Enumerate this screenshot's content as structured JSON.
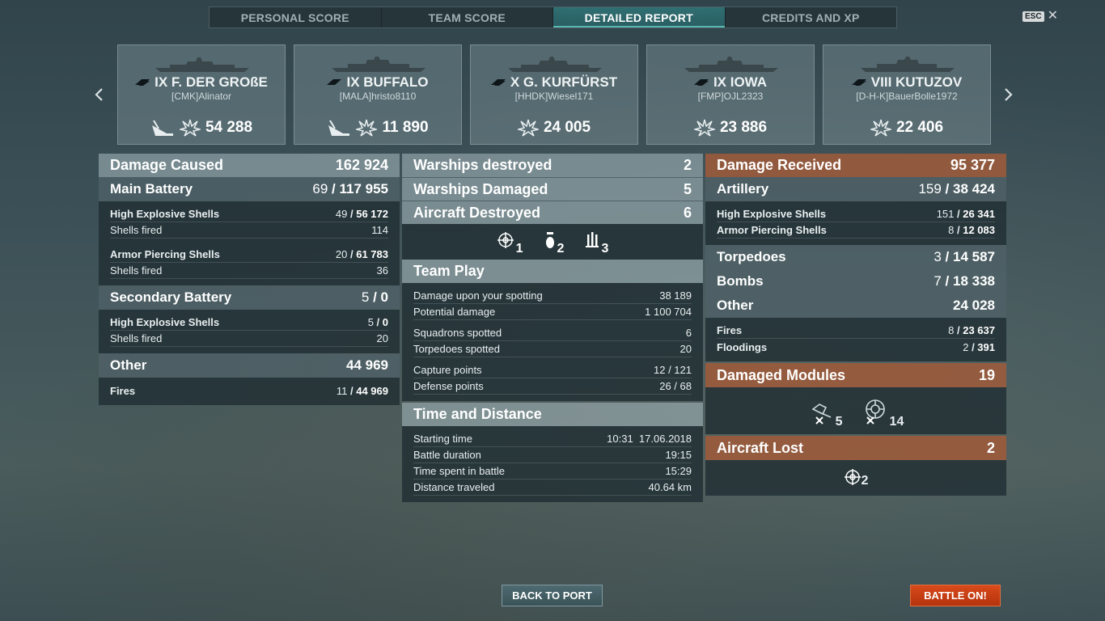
{
  "tabs": [
    {
      "label": "PERSONAL SCORE"
    },
    {
      "label": "TEAM SCORE"
    },
    {
      "label": "DETAILED REPORT"
    },
    {
      "label": "CREDITS AND XP"
    }
  ],
  "esc": {
    "key": "ESC",
    "close": "✕"
  },
  "ships": [
    {
      "name": "IX F. DER GROßE",
      "player": "[CMK]Alinator",
      "damage": "54 288",
      "sunk_icon": true
    },
    {
      "name": "IX BUFFALO",
      "player": "[MALA]hristo8110",
      "damage": "11 890",
      "sunk_icon": true
    },
    {
      "name": "X G. KURFÜRST",
      "player": "[HHDK]Wiesel171",
      "damage": "24 005",
      "sunk_icon": false
    },
    {
      "name": "IX IOWA",
      "player": "[FMP]OJL2323",
      "damage": "23 886",
      "sunk_icon": false
    },
    {
      "name": "VIII KUTUZOV",
      "player": "[D-H-K]BauerBolle1972",
      "damage": "22 406",
      "sunk_icon": false
    }
  ],
  "damage_caused": {
    "title": "Damage Caused",
    "total": "162 924",
    "main_battery": {
      "title": "Main Battery",
      "hits": "69",
      "dmg": "117 955"
    },
    "mb_rows": [
      {
        "label": "High Explosive Shells",
        "hits": "49",
        "dmg": "56 172",
        "bold": true
      },
      {
        "label": "Shells fired",
        "value": "114",
        "bold": false
      },
      {
        "label": "Armor Piercing Shells",
        "hits": "20",
        "dmg": "61 783",
        "bold": true
      },
      {
        "label": "Shells fired",
        "value": "36",
        "bold": false
      }
    ],
    "secondary": {
      "title": "Secondary Battery",
      "hits": "5",
      "dmg": "0"
    },
    "sec_rows": [
      {
        "label": "High Explosive Shells",
        "hits": "5",
        "dmg": "0"
      },
      {
        "label": "Shells fired",
        "value": "20"
      }
    ],
    "other": {
      "title": "Other",
      "total": "44 969"
    },
    "other_rows": [
      {
        "label": "Fires",
        "hits": "11",
        "dmg": "44 969"
      }
    ]
  },
  "middle": {
    "warships_destroyed": {
      "label": "Warships destroyed",
      "value": "2"
    },
    "warships_damaged": {
      "label": "Warships Damaged",
      "value": "5"
    },
    "aircraft_destroyed": {
      "label": "Aircraft Destroyed",
      "value": "6"
    },
    "aircraft_icons": [
      {
        "icon": "fighter-icon",
        "count": "1"
      },
      {
        "icon": "bomber-icon",
        "count": "2"
      },
      {
        "icon": "torpedo-bomber-icon",
        "count": "3"
      }
    ],
    "team_play": {
      "title": "Team Play"
    },
    "team_rows": [
      {
        "label": "Damage upon your spotting",
        "value": "38 189"
      },
      {
        "label": "Potential damage",
        "value": "1 100 704"
      },
      {
        "label": "Squadrons spotted",
        "value": "6"
      },
      {
        "label": "Torpedoes spotted",
        "value": "20"
      },
      {
        "label": "Capture points",
        "value": "12 / 121"
      },
      {
        "label": "Defense points",
        "value": "26 / 68"
      }
    ],
    "time_distance": {
      "title": "Time and Distance"
    },
    "time_rows": [
      {
        "label": "Starting time",
        "value": "10:31  17.06.2018"
      },
      {
        "label": "Battle duration",
        "value": "19:15"
      },
      {
        "label": "Time spent in battle",
        "value": "15:29"
      },
      {
        "label": "Distance traveled",
        "value": "40.64 km"
      }
    ]
  },
  "damage_received": {
    "title": "Damage Received",
    "total": "95 377",
    "artillery": {
      "title": "Artillery",
      "hits": "159",
      "dmg": "38 424"
    },
    "art_rows": [
      {
        "label": "High Explosive Shells",
        "hits": "151",
        "dmg": "26 341"
      },
      {
        "label": "Armor Piercing Shells",
        "hits": "8",
        "dmg": "12 083"
      }
    ],
    "torpedoes": {
      "title": "Torpedoes",
      "hits": "3",
      "dmg": "14 587"
    },
    "bombs": {
      "title": "Bombs",
      "hits": "7",
      "dmg": "18 338"
    },
    "other": {
      "title": "Other",
      "total": "24 028"
    },
    "other_rows": [
      {
        "label": "Fires",
        "hits": "8",
        "dmg": "23 637"
      },
      {
        "label": "Floodings",
        "hits": "2",
        "dmg": "391"
      }
    ],
    "modules": {
      "title": "Damaged Modules",
      "total": "19",
      "turret_count": "5",
      "engine_count": "14"
    },
    "aircraft_lost": {
      "title": "Aircraft Lost",
      "total": "2",
      "count": "2"
    }
  },
  "buttons": {
    "back": "BACK TO PORT",
    "battle": "BATTLE ON!"
  }
}
